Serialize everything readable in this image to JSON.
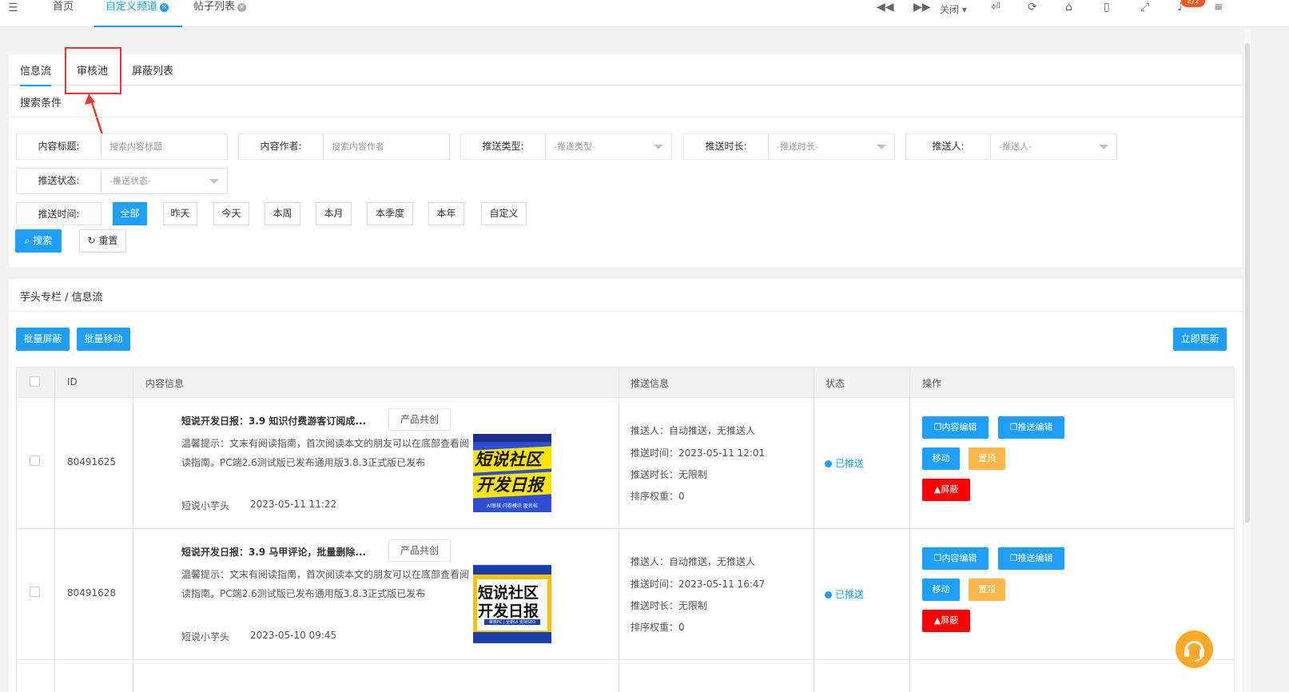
{
  "topbar": {
    "tabs": [
      {
        "label": "首页"
      },
      {
        "label": "自定义频道"
      },
      {
        "label": "帖子列表"
      }
    ],
    "close_label": "关闭",
    "notification_badge": "2/2"
  },
  "subtabs": [
    "信息流",
    "审核池",
    "屏蔽列表"
  ],
  "search": {
    "section_title": "搜索条件",
    "fields": [
      {
        "label": "内容标题:",
        "placeholder": "搜索内容标题"
      },
      {
        "label": "内容作者:",
        "placeholder": "搜索内容作者"
      },
      {
        "label": "推送类型:",
        "placeholder": "-推送类型-"
      },
      {
        "label": "推送时长:",
        "placeholder": "-推送时长-"
      },
      {
        "label": "推送人:",
        "placeholder": "-推送人-"
      },
      {
        "label": "推送状态:",
        "placeholder": "-推送状态-"
      }
    ],
    "time_label": "推送时间:",
    "time_options": [
      "全部",
      "昨天",
      "今天",
      "本周",
      "本月",
      "本季度",
      "本年",
      "自定义"
    ],
    "search_button": "搜索",
    "reset_button": "重置"
  },
  "list": {
    "breadcrumb": "芋头专栏 / 信息流",
    "batch_block": "批量屏蔽",
    "batch_move": "批量移动",
    "update_now": "立即更新",
    "columns": [
      "ID",
      "内容信息",
      "推送信息",
      "状态",
      "操作"
    ],
    "rows": [
      {
        "id": "80491625",
        "title": "短说开发日报：3.9 知识付费游客订阅成...",
        "tag": "产品共创",
        "summary": "温馨提示：文末有阅读指南，首次阅读本文的朋友可以在底部查看阅读指南。PC端2.6测试版已发布通用版3.8.3正式版已发布",
        "author": "短说小芋头",
        "date": "2023-05-11 11:22",
        "thumb_line1": "短说社区",
        "thumb_line2": "开发日报",
        "thumb_footer": "AI审核 闪卷模块 匿名帖",
        "push_person": "推送人：自动推送，无推送人",
        "push_time": "推送时间：2023-05-11 12:01",
        "push_duration": "推送时长：无限制",
        "sort_weight": "排序权重：0",
        "status": "已推送"
      },
      {
        "id": "80491628",
        "title": "短说开发日报：3.9 马甲评论，批量删除...",
        "tag": "产品共创",
        "summary": "温馨提示：文末有阅读指南，首次阅读本文的朋友可以在底部查看阅读指南。PC端2.6测试版已发布通用版3.8.3正式版已发布",
        "author": "短说小芋头",
        "date": "2023-05-10 09:45",
        "thumb_line1": "短说社区",
        "thumb_line2": "开发日报",
        "thumb_footer": "审核PC | 全新UI 支持SEO",
        "push_person": "推送人：自动推送，无推送人",
        "push_time": "推送时间：2023-05-11 16:47",
        "push_duration": "推送时长：无限制",
        "sort_weight": "排序权重：0",
        "status": "已推送"
      }
    ],
    "actions": {
      "content_edit": "内容编辑",
      "push_edit": "推送编辑",
      "move": "移动",
      "pin": "置顶",
      "block": "屏蔽"
    }
  },
  "colors": {
    "primary": "#1e9fff",
    "warning": "#ffb74d",
    "danger": "#ff0000",
    "annotation": "#e53935"
  }
}
